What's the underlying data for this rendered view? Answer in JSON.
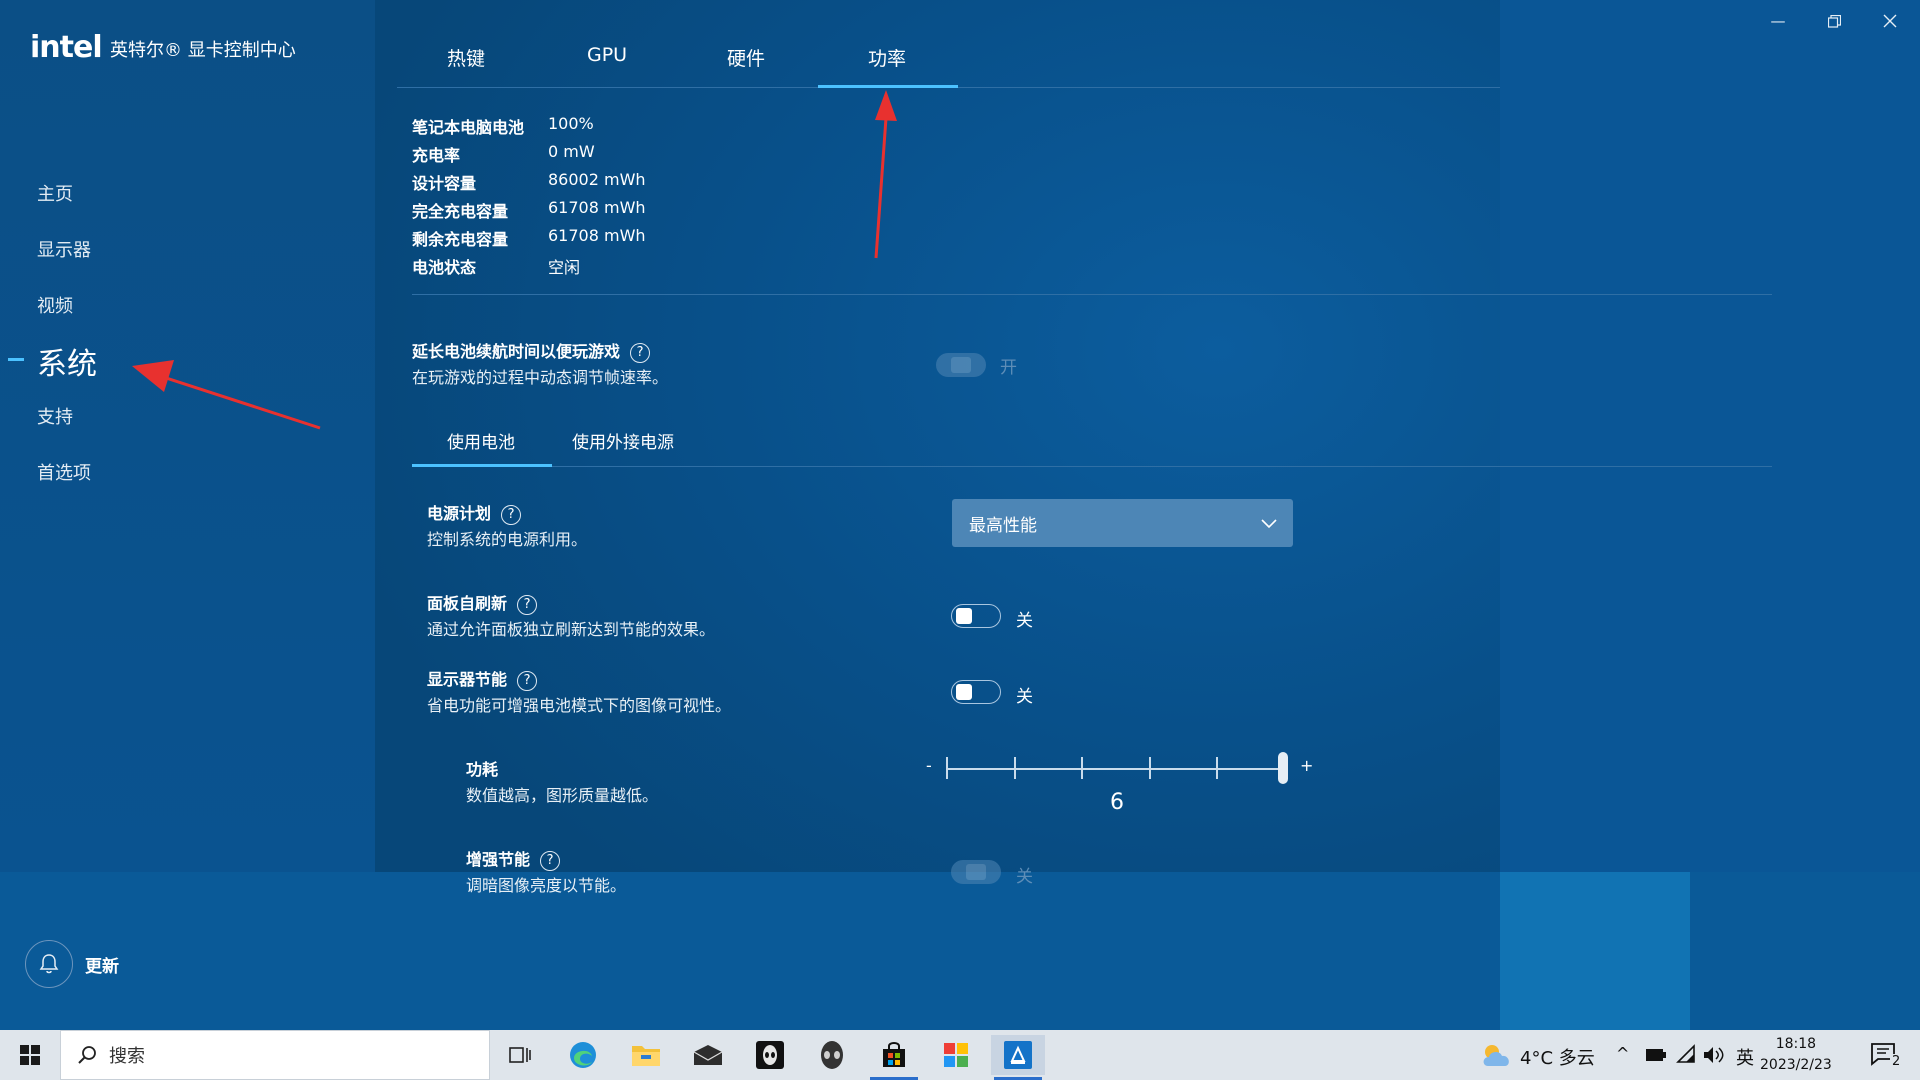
{
  "app": {
    "logo": "intel",
    "title": "英特尔® 显卡控制中心"
  },
  "sidebar": {
    "items": [
      {
        "label": "主页"
      },
      {
        "label": "显示器"
      },
      {
        "label": "视频"
      },
      {
        "label": "系统"
      },
      {
        "label": "支持"
      },
      {
        "label": "首选项"
      }
    ],
    "active": "系统",
    "update_label": "更新"
  },
  "tabs": {
    "items": [
      {
        "label": "热键"
      },
      {
        "label": "GPU"
      },
      {
        "label": "硬件"
      },
      {
        "label": "功率"
      }
    ],
    "active": "功率"
  },
  "battery": {
    "rows": [
      {
        "label": "笔记本电脑电池",
        "value": "100%"
      },
      {
        "label": "充电率",
        "value": "0 mW"
      },
      {
        "label": "设计容量",
        "value": "86002 mWh"
      },
      {
        "label": "完全充电容量",
        "value": "61708 mWh"
      },
      {
        "label": "剩余充电容量",
        "value": "61708 mWh"
      },
      {
        "label": "电池状态",
        "value": "空闲"
      }
    ]
  },
  "extend_battery": {
    "title": "延长电池续航时间以便玩游戏",
    "desc": "在玩游戏的过程中动态调节帧速率。",
    "state": "开",
    "enabled": false
  },
  "power_tabs": {
    "items": [
      {
        "label": "使用电池"
      },
      {
        "label": "使用外接电源"
      }
    ],
    "active": "使用电池"
  },
  "power_plan": {
    "title": "电源计划",
    "desc": "控制系统的电源利用。",
    "selected": "最高性能"
  },
  "panel_self_refresh": {
    "title": "面板自刷新",
    "desc": "通过允许面板独立刷新达到节能的效果。",
    "state": "关"
  },
  "display_power_saving": {
    "title": "显示器节能",
    "desc": "省电功能可增强电池模式下的图像可视性。",
    "state": "关"
  },
  "power_consumption": {
    "title": "功耗",
    "desc": "数值越高，图形质量越低。",
    "min_label": "-",
    "max_label": "+",
    "value": "6",
    "level_fraction": 1.0
  },
  "enhanced_saving": {
    "title": "增强节能",
    "desc": "调暗图像亮度以节能。",
    "state": "关",
    "enabled": false
  },
  "taskbar": {
    "search_placeholder": "搜索",
    "weather": "4°C 多云",
    "ime": "英",
    "time": "18:18",
    "date": "2023/2/23",
    "notification_count": "2"
  },
  "colors": {
    "accent": "#4cc2ff",
    "annotation_arrow": "#e8312f"
  }
}
